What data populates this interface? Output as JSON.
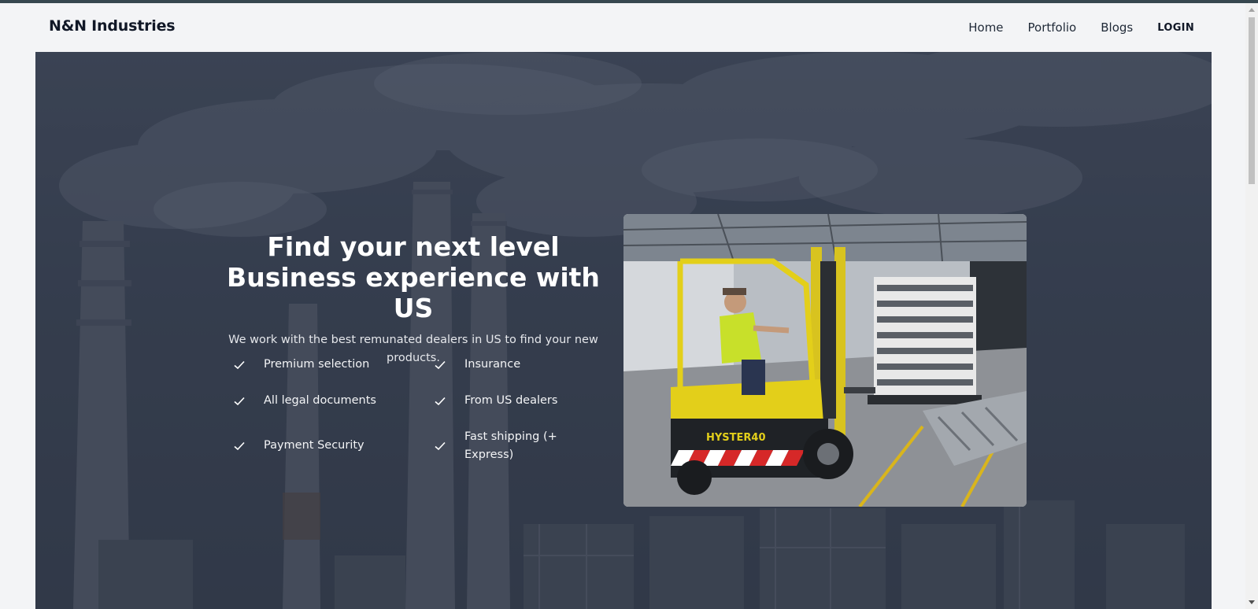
{
  "brand": {
    "name": "N&N Industries"
  },
  "nav": {
    "home": "Home",
    "portfolio": "Portfolio",
    "blogs": "Blogs",
    "login": "LOGIN"
  },
  "hero": {
    "title": "Find your next level Business experience with US",
    "subtitle": "We work with the best remunated dealers in US to find your new products.",
    "features": [
      {
        "label": "Premium selection",
        "icon": "check-icon"
      },
      {
        "label": "Insurance",
        "icon": "check-icon"
      },
      {
        "label": "All legal documents",
        "icon": "check-icon"
      },
      {
        "label": "From US dealers",
        "icon": "check-icon"
      },
      {
        "label": "Payment Security",
        "icon": "check-icon"
      },
      {
        "label": "Fast shipping (+ Express)",
        "icon": "check-icon"
      }
    ],
    "image": {
      "subject": "forklift-warehouse-photo",
      "forklift_text": "HYSTER40"
    }
  },
  "colors": {
    "page_bg": "#f3f4f6",
    "top_line": "#37474f",
    "hero_overlay": "#3b4254",
    "text_dark": "#111827",
    "text_light": "#ffffff"
  }
}
